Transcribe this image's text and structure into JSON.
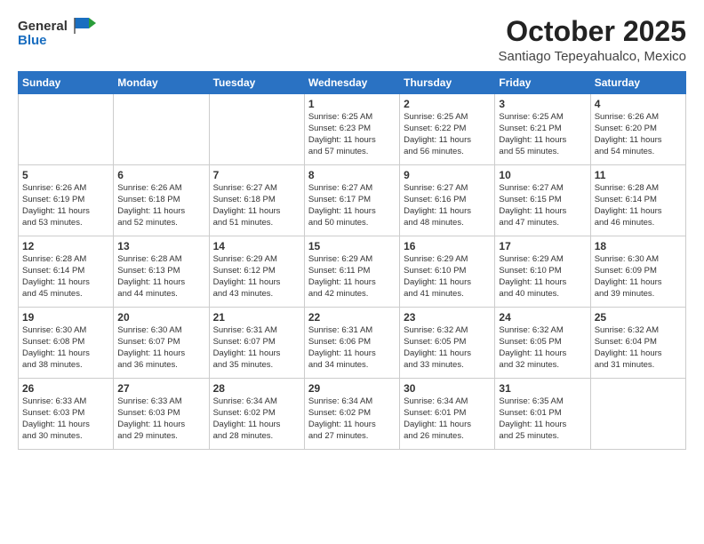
{
  "header": {
    "logo_general": "General",
    "logo_blue": "Blue",
    "month_title": "October 2025",
    "subtitle": "Santiago Tepeyahualco, Mexico"
  },
  "days_of_week": [
    "Sunday",
    "Monday",
    "Tuesday",
    "Wednesday",
    "Thursday",
    "Friday",
    "Saturday"
  ],
  "weeks": [
    {
      "row_class": "row-odd",
      "days": [
        {
          "num": "",
          "info": "",
          "empty": true
        },
        {
          "num": "",
          "info": "",
          "empty": true
        },
        {
          "num": "",
          "info": "",
          "empty": true
        },
        {
          "num": "1",
          "info": "Sunrise: 6:25 AM\nSunset: 6:23 PM\nDaylight: 11 hours\nand 57 minutes.",
          "empty": false
        },
        {
          "num": "2",
          "info": "Sunrise: 6:25 AM\nSunset: 6:22 PM\nDaylight: 11 hours\nand 56 minutes.",
          "empty": false
        },
        {
          "num": "3",
          "info": "Sunrise: 6:25 AM\nSunset: 6:21 PM\nDaylight: 11 hours\nand 55 minutes.",
          "empty": false
        },
        {
          "num": "4",
          "info": "Sunrise: 6:26 AM\nSunset: 6:20 PM\nDaylight: 11 hours\nand 54 minutes.",
          "empty": false
        }
      ]
    },
    {
      "row_class": "row-even",
      "days": [
        {
          "num": "5",
          "info": "Sunrise: 6:26 AM\nSunset: 6:19 PM\nDaylight: 11 hours\nand 53 minutes.",
          "empty": false
        },
        {
          "num": "6",
          "info": "Sunrise: 6:26 AM\nSunset: 6:18 PM\nDaylight: 11 hours\nand 52 minutes.",
          "empty": false
        },
        {
          "num": "7",
          "info": "Sunrise: 6:27 AM\nSunset: 6:18 PM\nDaylight: 11 hours\nand 51 minutes.",
          "empty": false
        },
        {
          "num": "8",
          "info": "Sunrise: 6:27 AM\nSunset: 6:17 PM\nDaylight: 11 hours\nand 50 minutes.",
          "empty": false
        },
        {
          "num": "9",
          "info": "Sunrise: 6:27 AM\nSunset: 6:16 PM\nDaylight: 11 hours\nand 48 minutes.",
          "empty": false
        },
        {
          "num": "10",
          "info": "Sunrise: 6:27 AM\nSunset: 6:15 PM\nDaylight: 11 hours\nand 47 minutes.",
          "empty": false
        },
        {
          "num": "11",
          "info": "Sunrise: 6:28 AM\nSunset: 6:14 PM\nDaylight: 11 hours\nand 46 minutes.",
          "empty": false
        }
      ]
    },
    {
      "row_class": "row-odd",
      "days": [
        {
          "num": "12",
          "info": "Sunrise: 6:28 AM\nSunset: 6:14 PM\nDaylight: 11 hours\nand 45 minutes.",
          "empty": false
        },
        {
          "num": "13",
          "info": "Sunrise: 6:28 AM\nSunset: 6:13 PM\nDaylight: 11 hours\nand 44 minutes.",
          "empty": false
        },
        {
          "num": "14",
          "info": "Sunrise: 6:29 AM\nSunset: 6:12 PM\nDaylight: 11 hours\nand 43 minutes.",
          "empty": false
        },
        {
          "num": "15",
          "info": "Sunrise: 6:29 AM\nSunset: 6:11 PM\nDaylight: 11 hours\nand 42 minutes.",
          "empty": false
        },
        {
          "num": "16",
          "info": "Sunrise: 6:29 AM\nSunset: 6:10 PM\nDaylight: 11 hours\nand 41 minutes.",
          "empty": false
        },
        {
          "num": "17",
          "info": "Sunrise: 6:29 AM\nSunset: 6:10 PM\nDaylight: 11 hours\nand 40 minutes.",
          "empty": false
        },
        {
          "num": "18",
          "info": "Sunrise: 6:30 AM\nSunset: 6:09 PM\nDaylight: 11 hours\nand 39 minutes.",
          "empty": false
        }
      ]
    },
    {
      "row_class": "row-even",
      "days": [
        {
          "num": "19",
          "info": "Sunrise: 6:30 AM\nSunset: 6:08 PM\nDaylight: 11 hours\nand 38 minutes.",
          "empty": false
        },
        {
          "num": "20",
          "info": "Sunrise: 6:30 AM\nSunset: 6:07 PM\nDaylight: 11 hours\nand 36 minutes.",
          "empty": false
        },
        {
          "num": "21",
          "info": "Sunrise: 6:31 AM\nSunset: 6:07 PM\nDaylight: 11 hours\nand 35 minutes.",
          "empty": false
        },
        {
          "num": "22",
          "info": "Sunrise: 6:31 AM\nSunset: 6:06 PM\nDaylight: 11 hours\nand 34 minutes.",
          "empty": false
        },
        {
          "num": "23",
          "info": "Sunrise: 6:32 AM\nSunset: 6:05 PM\nDaylight: 11 hours\nand 33 minutes.",
          "empty": false
        },
        {
          "num": "24",
          "info": "Sunrise: 6:32 AM\nSunset: 6:05 PM\nDaylight: 11 hours\nand 32 minutes.",
          "empty": false
        },
        {
          "num": "25",
          "info": "Sunrise: 6:32 AM\nSunset: 6:04 PM\nDaylight: 11 hours\nand 31 minutes.",
          "empty": false
        }
      ]
    },
    {
      "row_class": "row-odd",
      "days": [
        {
          "num": "26",
          "info": "Sunrise: 6:33 AM\nSunset: 6:03 PM\nDaylight: 11 hours\nand 30 minutes.",
          "empty": false
        },
        {
          "num": "27",
          "info": "Sunrise: 6:33 AM\nSunset: 6:03 PM\nDaylight: 11 hours\nand 29 minutes.",
          "empty": false
        },
        {
          "num": "28",
          "info": "Sunrise: 6:34 AM\nSunset: 6:02 PM\nDaylight: 11 hours\nand 28 minutes.",
          "empty": false
        },
        {
          "num": "29",
          "info": "Sunrise: 6:34 AM\nSunset: 6:02 PM\nDaylight: 11 hours\nand 27 minutes.",
          "empty": false
        },
        {
          "num": "30",
          "info": "Sunrise: 6:34 AM\nSunset: 6:01 PM\nDaylight: 11 hours\nand 26 minutes.",
          "empty": false
        },
        {
          "num": "31",
          "info": "Sunrise: 6:35 AM\nSunset: 6:01 PM\nDaylight: 11 hours\nand 25 minutes.",
          "empty": false
        },
        {
          "num": "",
          "info": "",
          "empty": true
        }
      ]
    }
  ]
}
